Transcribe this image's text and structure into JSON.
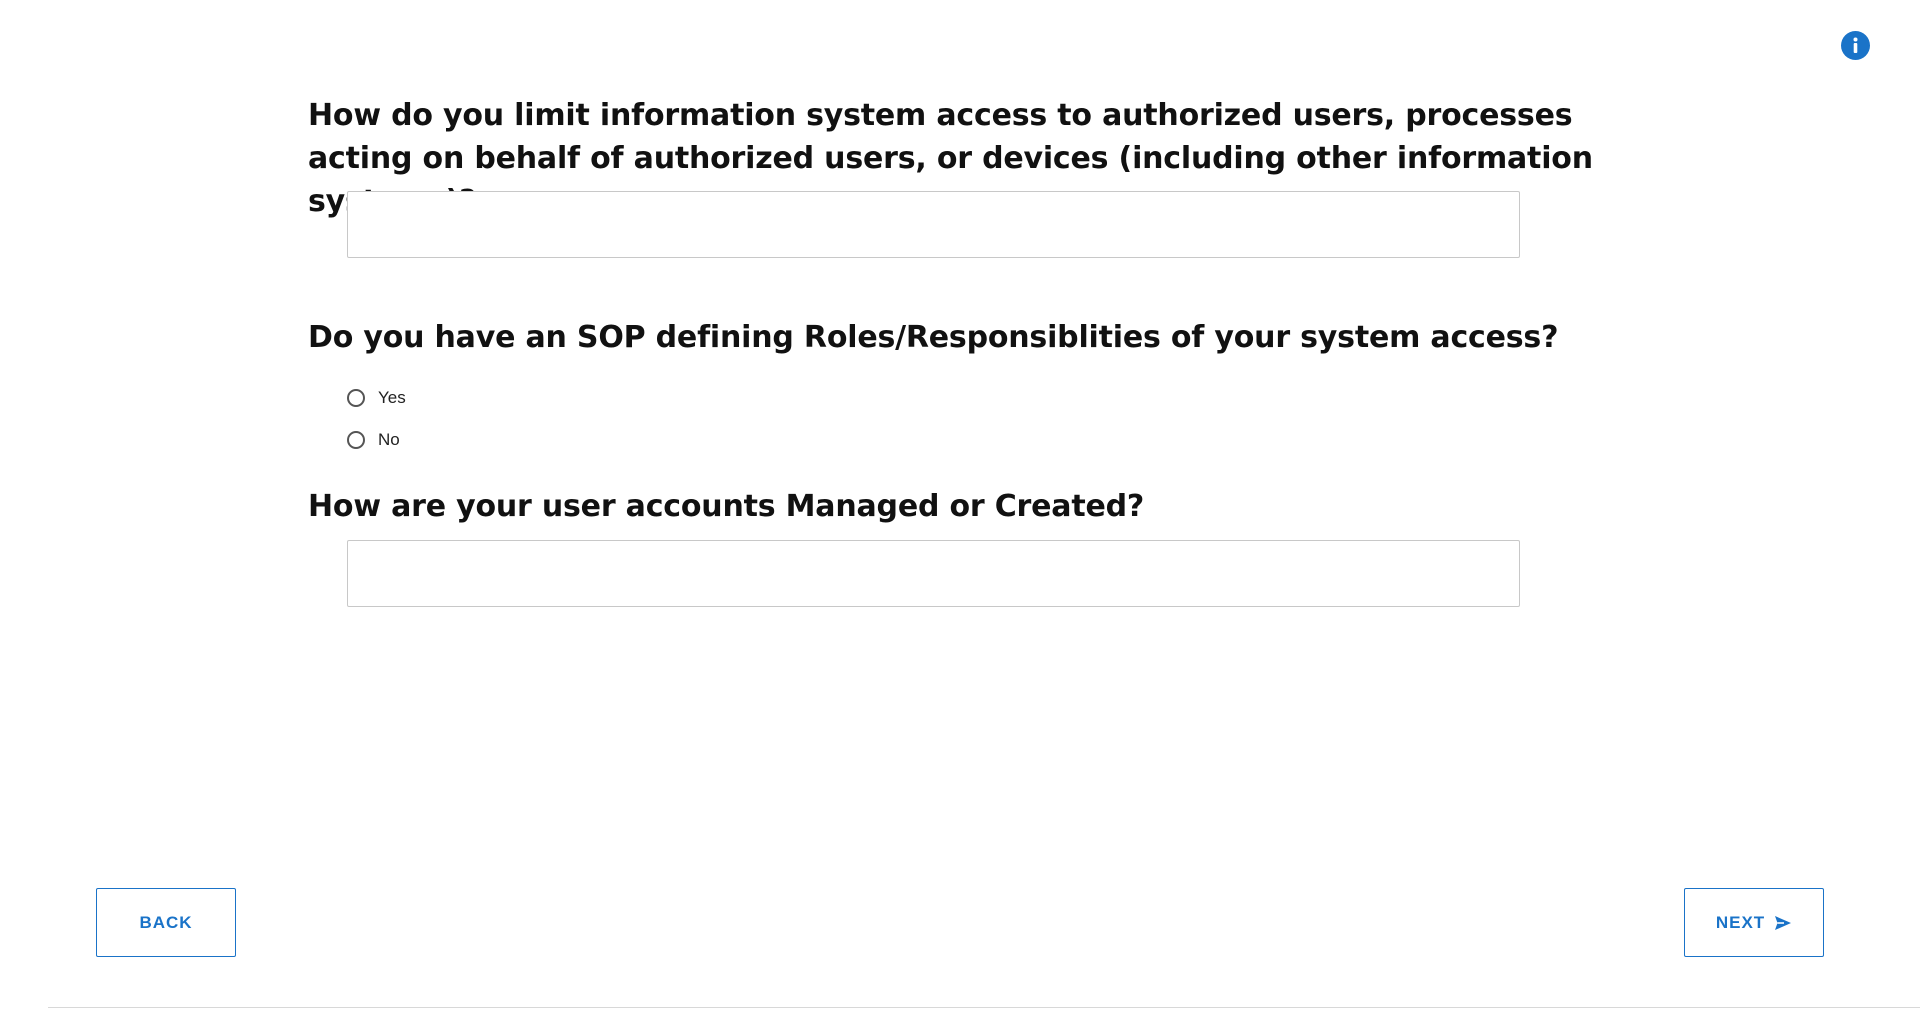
{
  "header": {
    "info_icon": "info-icon"
  },
  "questions": [
    {
      "text": "How do you limit information system access to authorized users, processes acting on behalf of authorized users, or devices (including other information systems)?",
      "answer": ""
    },
    {
      "text": "Do you have an SOP defining Roles/Responsiblities of your system access?",
      "options": [
        {
          "label": "Yes",
          "selected": false
        },
        {
          "label": "No",
          "selected": false
        }
      ]
    },
    {
      "text": "How are your user accounts Managed or Created?",
      "answer": ""
    }
  ],
  "navigation": {
    "back_label": "BACK",
    "next_label": "NEXT",
    "next_icon": "send-arrow-icon"
  },
  "colors": {
    "accent": "#1a73c8",
    "text": "#111111",
    "border": "#c8c8c8"
  }
}
